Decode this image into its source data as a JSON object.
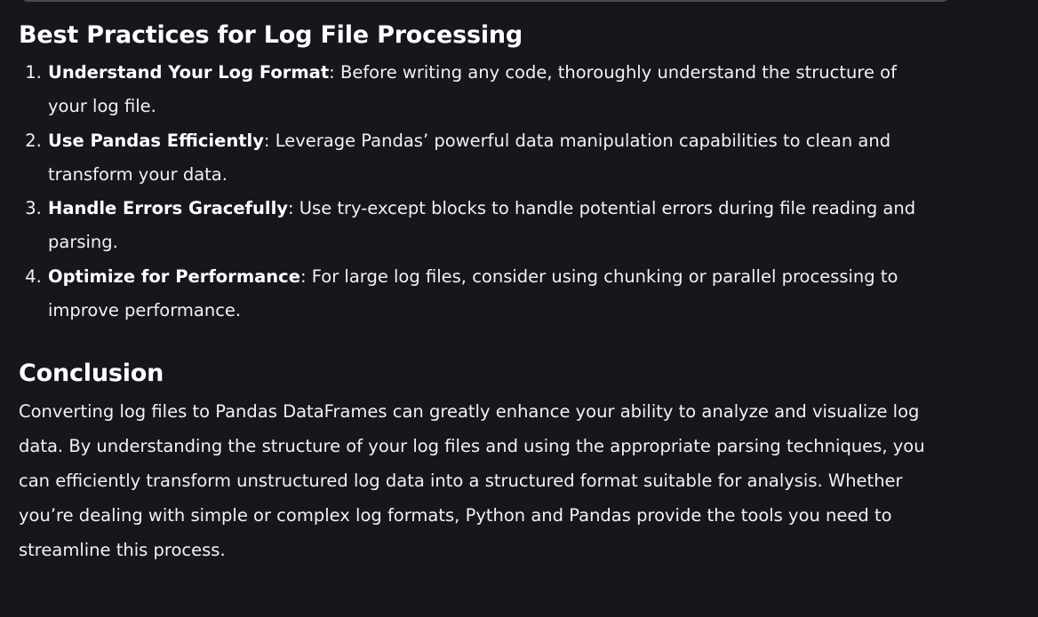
{
  "best_practices": {
    "heading": "Best Practices for Log File Processing",
    "items": [
      {
        "term": "Understand Your Log Format",
        "text": ": Before writing any code, thoroughly understand the structure of your log file."
      },
      {
        "term": "Use Pandas Efficiently",
        "text": ": Leverage Pandas’ powerful data manipulation capabilities to clean and transform your data."
      },
      {
        "term": "Handle Errors Gracefully",
        "text": ": Use try-except blocks to handle potential errors during file reading and parsing."
      },
      {
        "term": "Optimize for Performance",
        "text": ": For large log files, consider using chunking or parallel processing to improve performance."
      }
    ]
  },
  "conclusion": {
    "heading": "Conclusion",
    "body": "Converting log files to Pandas DataFrames can greatly enhance your ability to analyze and visualize log data. By understanding the structure of your log files and using the appropriate parsing techniques, you can efficiently transform unstructured log data into a structured format suitable for analysis. Whether you’re dealing with simple or complex log formats, Python and Pandas provide the tools you need to streamline this process."
  }
}
